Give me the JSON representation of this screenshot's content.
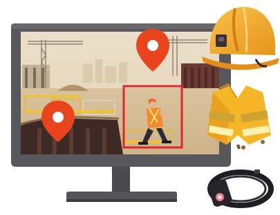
{
  "scene": {
    "monitor": {
      "bezel_color": "#58575c",
      "stand_color": "#4d4c51"
    },
    "markers": [
      {
        "name": "map-pin-icon-upper",
        "color": "#e8451f"
      },
      {
        "name": "map-pin-icon-left",
        "color": "#e8451f"
      }
    ],
    "detection_box": {
      "color": "#e0262b"
    },
    "wearables": [
      "hard-hat-icon",
      "safety-vest-icon",
      "wristband-tracker-icon"
    ],
    "colors": {
      "helmet": "#f2a91f",
      "vest": "#f5b628",
      "sky": "#e9dcc4",
      "ground": "#dccaa6",
      "fence": "#f1c233"
    }
  }
}
